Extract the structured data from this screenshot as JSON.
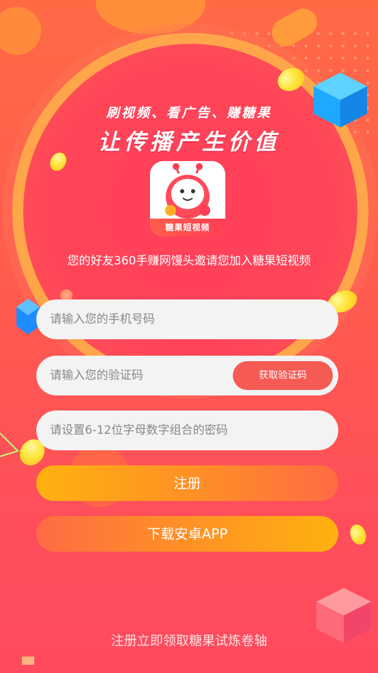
{
  "banner": {
    "tagline": "刷视频、看广告、赚糖果",
    "headline": "让传播产生价值"
  },
  "app": {
    "icon_label": "糖果短视频"
  },
  "invite": {
    "text": "您的好友360手赚网馒头邀请您加入糖果短视频"
  },
  "form": {
    "phone_placeholder": "请输入您的手机号码",
    "code_placeholder": "请输入您的验证码",
    "get_code_label": "获取验证码",
    "password_placeholder": "请设置6-12位字母数字组合的密码",
    "register_label": "注册",
    "download_label": "下载安卓APP"
  },
  "footer": {
    "text": "注册立即领取糖果试炼卷轴"
  },
  "colors": {
    "accent": "#f55a55",
    "button_gold": "#ffb20f",
    "ring": "#ffa64a"
  }
}
